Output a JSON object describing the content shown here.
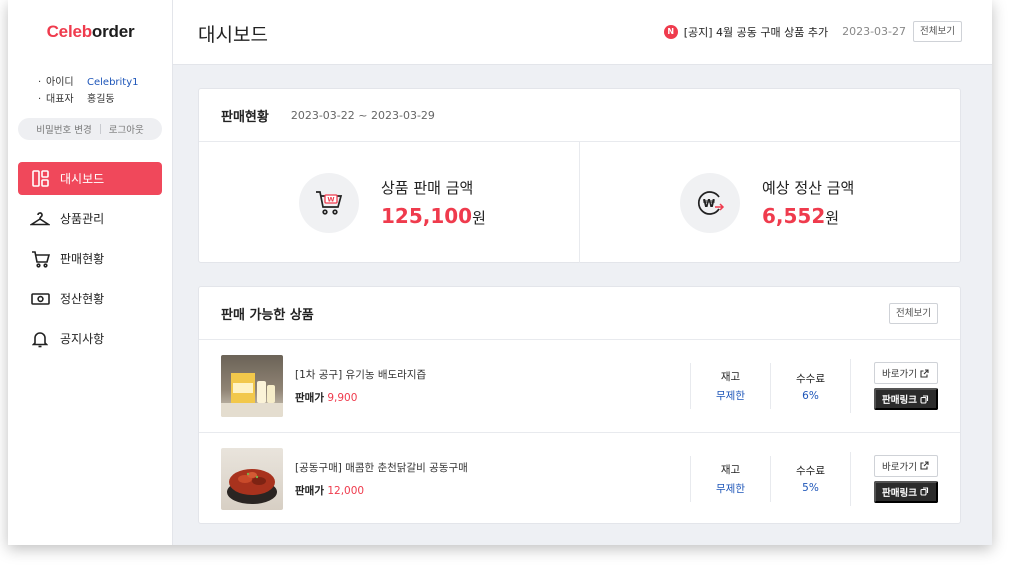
{
  "brand": {
    "part1": "Celeb",
    "part2": "order",
    "accent": "#ef3b4d"
  },
  "account": {
    "id_label": "아이디",
    "id_value": "Celebrity1",
    "rep_label": "대표자",
    "rep_value": "홍길동",
    "change_password": "비밀번호 변경",
    "logout": "로그아웃"
  },
  "nav": [
    {
      "label": "대시보드",
      "icon": "dashboard-icon",
      "active": true
    },
    {
      "label": "상품관리",
      "icon": "hanger-icon",
      "active": false
    },
    {
      "label": "판매현황",
      "icon": "cart-icon",
      "active": false
    },
    {
      "label": "정산현황",
      "icon": "cash-icon",
      "active": false
    },
    {
      "label": "공지사항",
      "icon": "bell-icon",
      "active": false
    }
  ],
  "header": {
    "title": "대시보드",
    "notice_badge": "N",
    "notice_text": "[공지] 4월 공동 구매 상품 추가",
    "notice_date": "2023-03-27",
    "view_all": "전체보기"
  },
  "sales": {
    "title": "판매현황",
    "range": "2023-03-22 ~ 2023-03-29",
    "product_sales_label": "상품 판매 금액",
    "product_sales_value": "125,100",
    "expected_settlement_label": "예상 정산 금액",
    "expected_settlement_value": "6,552",
    "unit": "원"
  },
  "products": {
    "title": "판매 가능한 상품",
    "view_all": "전체보기",
    "price_label": "판매가",
    "stock_label": "재고",
    "fee_label": "수수료",
    "go_label": "바로가기",
    "link_label": "판매링크",
    "items": [
      {
        "name": "[1차 공구] 유기농 배도라지즙",
        "price": "9,900",
        "stock": "무제한",
        "fee": "6%"
      },
      {
        "name": "[공동구매] 매콤한 춘천닭갈비 공동구매",
        "price": "12,000",
        "stock": "무제한",
        "fee": "5%"
      }
    ]
  }
}
